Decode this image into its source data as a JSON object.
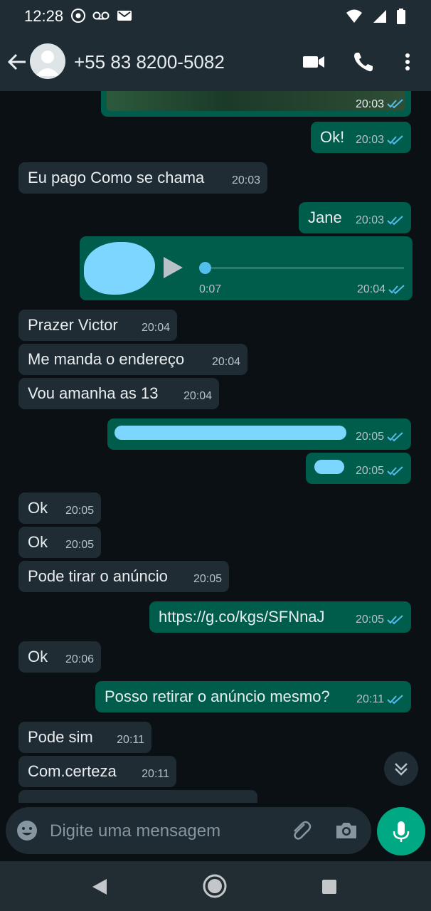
{
  "status_bar": {
    "time": "12:28",
    "left_icons": [
      "chrome-icon",
      "voicemail-icon",
      "gmail-icon"
    ],
    "right_icons": [
      "wifi-icon",
      "signal-icon",
      "battery-icon"
    ]
  },
  "header": {
    "contact_name": "+55 83 8200-5082",
    "actions": [
      "video-call-icon",
      "phone-icon",
      "more-vert-icon"
    ]
  },
  "messages": [
    {
      "dir": "out",
      "type": "image",
      "time": "20:03",
      "status": "read"
    },
    {
      "dir": "out",
      "text": "Ok!",
      "time": "20:03",
      "status": "read"
    },
    {
      "dir": "in",
      "text": "Eu pago Como se chama",
      "time": "20:03"
    },
    {
      "dir": "out",
      "text": "Jane",
      "time": "20:03",
      "status": "read"
    },
    {
      "dir": "out",
      "type": "audio",
      "duration": "0:07",
      "progress": 0,
      "time": "20:04",
      "status": "read"
    },
    {
      "dir": "in",
      "text": "Prazer Victor",
      "time": "20:04"
    },
    {
      "dir": "in",
      "text": "Me manda o endereço",
      "time": "20:04"
    },
    {
      "dir": "in",
      "text": "Vou amanha as 13",
      "time": "20:04"
    },
    {
      "dir": "out",
      "type": "redacted",
      "time": "20:05",
      "status": "read"
    },
    {
      "dir": "out",
      "type": "redacted",
      "time": "20:05",
      "status": "read"
    },
    {
      "dir": "in",
      "text": "Ok",
      "time": "20:05"
    },
    {
      "dir": "in",
      "text": "Ok",
      "time": "20:05"
    },
    {
      "dir": "in",
      "text": "Pode tirar o anúncio",
      "time": "20:05"
    },
    {
      "dir": "out",
      "text": "https://g.co/kgs/SFNnaJ",
      "time": "20:05",
      "status": "read",
      "is_link": true
    },
    {
      "dir": "in",
      "text": "Ok",
      "time": "20:06"
    },
    {
      "dir": "out",
      "text": "Posso retirar o anúncio mesmo?",
      "time": "20:11",
      "status": "read"
    },
    {
      "dir": "in",
      "text": "Pode sim",
      "time": "20:11"
    },
    {
      "dir": "in",
      "text": "Com.certeza",
      "time": "20:11"
    }
  ],
  "input": {
    "placeholder": "Digite uma mensagem"
  },
  "colors": {
    "background": "#0b1014",
    "bar": "#1f2c34",
    "bubble_out": "#005c4b",
    "bubble_in": "#1f2c34",
    "accent": "#00a884",
    "read_ticks": "#53bdeb"
  },
  "nav": [
    "back-nav-icon",
    "home-nav-icon",
    "recents-nav-icon"
  ]
}
